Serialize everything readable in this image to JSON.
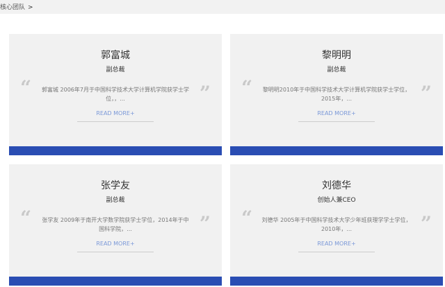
{
  "breadcrumb": {
    "label": "核心团队",
    "separator": ">"
  },
  "cards": [
    {
      "name": "郭富城",
      "title": "副总裁",
      "description": "郭富城 2006年7月于中国科学技术大学计算机学院获学士学位，，...",
      "more": "READ MORE+"
    },
    {
      "name": "黎明明",
      "title": "副总裁",
      "description": "黎明明2010年于中国科学技术大学计算机学院获学士学位，2015年，...",
      "more": "READ MORE+"
    },
    {
      "name": "张学友",
      "title": "副总裁",
      "description": "张学友 2009年于南开大学数学院获学士学位，2014年于中国科学院，...",
      "more": "READ MORE+"
    },
    {
      "name": "刘德华",
      "title": "创始人兼CEO",
      "description": "刘德华 2005年于中国科学技术大学少年班获理学学士学位，2010年，...",
      "more": "READ MORE+"
    }
  ],
  "colors": {
    "accent_band": "#2a4db3",
    "link": "#7a98d8",
    "card_bg": "#f1f1f1"
  },
  "icons": {
    "open_quote": "open-quote-icon",
    "close_quote": "close-quote-icon"
  },
  "quote_glyphs": {
    "open": "“",
    "close": "”"
  }
}
